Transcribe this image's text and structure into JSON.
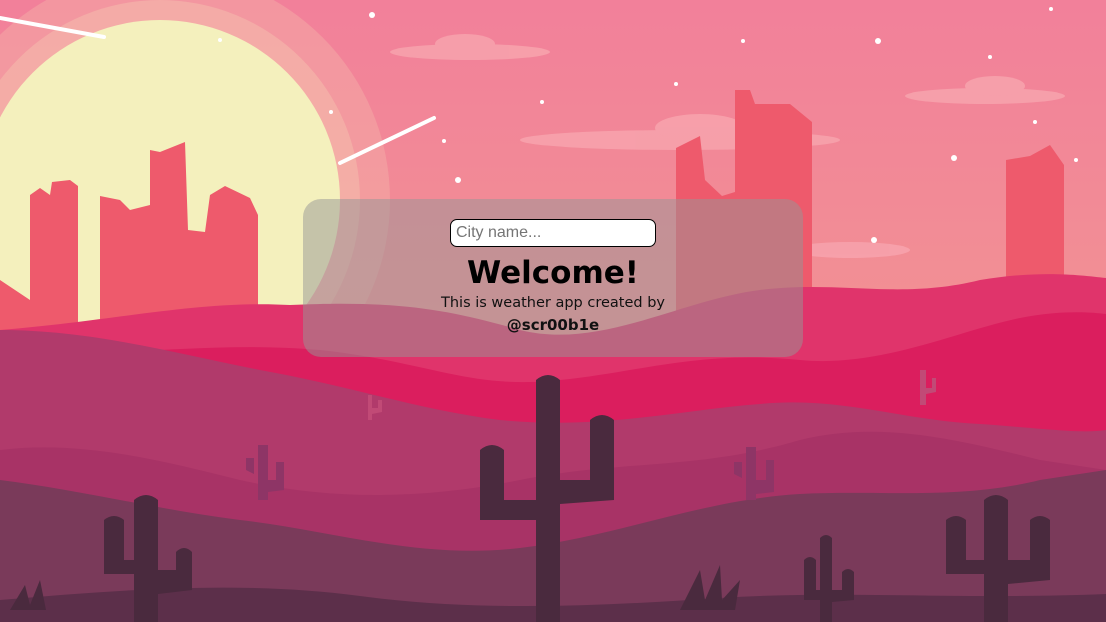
{
  "search": {
    "placeholder": "City name...",
    "value": ""
  },
  "welcome": {
    "title": "Welcome!",
    "subtitle": "This is weather app created by",
    "author": "@scr00b1e"
  },
  "background": {
    "description_icon": "desert-sunset-illustration",
    "colors": {
      "sky_top": "#f2809a",
      "sky_bottom": "#f2a08e",
      "sun": "#f4f0bd",
      "buildings": "#ee5a6c",
      "hills_far": "#db1e5e",
      "hills_mid": "#b13a6b",
      "hills_near": "#7a3a5a",
      "cactus": "#4a2a3e"
    }
  }
}
